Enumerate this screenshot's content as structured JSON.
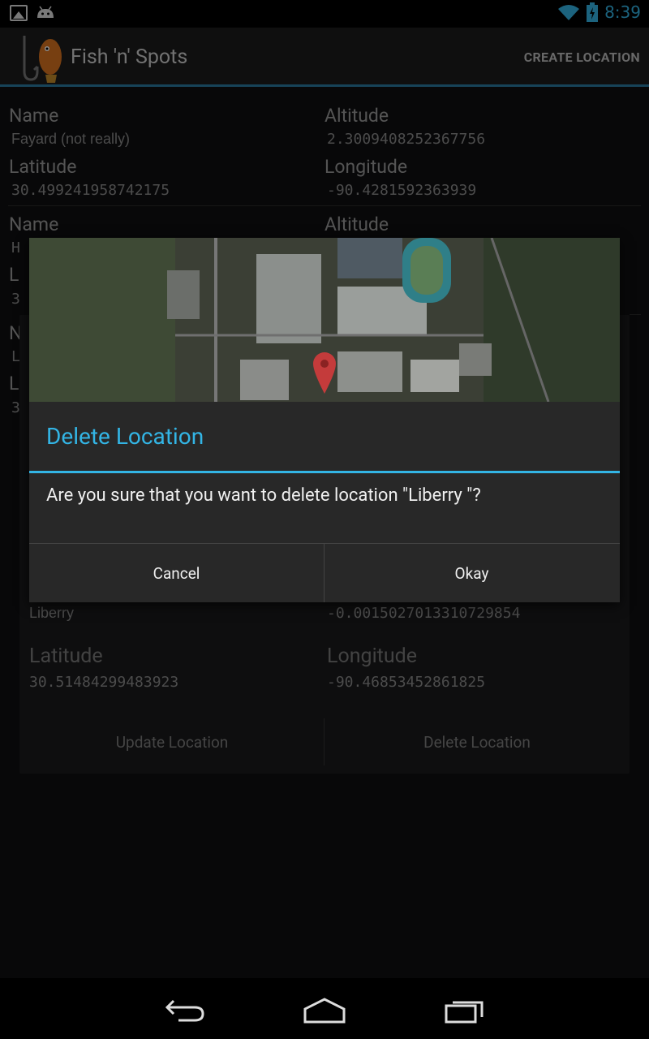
{
  "status_bar": {
    "time": "8:39",
    "left_icons": [
      "image-notification-icon",
      "android-notification-icon"
    ],
    "right_icons": [
      "wifi-icon",
      "battery-charging-icon"
    ],
    "accent_color": "#33b5e5"
  },
  "action_bar": {
    "app_title": "Fish 'n' Spots",
    "create_location_label": "CREATE LOCATION"
  },
  "locations": [
    {
      "name_label": "Name",
      "name": "Fayard (not really)",
      "altitude_label": "Altitude",
      "altitude": "2.3009408252367756",
      "latitude_label": "Latitude",
      "latitude": "30.499241958742175",
      "longitude_label": "Longitude",
      "longitude": "-90.4281592363939"
    }
  ],
  "partial_labels": {
    "name": "Name",
    "altitude": "Altitude",
    "row2_name_initial": "H",
    "row2_lat_initial": "L",
    "row2_lat_value_initial": "3",
    "row3_name_initial": "N",
    "row3_name_value_initial": "L",
    "row3_lat_initial": "L",
    "row3_lat_value_initial": "3"
  },
  "edit_card": {
    "name": "Liberry",
    "altitude": "-0.0015027013310729854",
    "latitude_label": "Latitude",
    "latitude": "30.51484299483923",
    "longitude_label": "Longitude",
    "longitude": "-90.46853452861825",
    "update_button": "Update Location",
    "delete_button": "Delete Location"
  },
  "dialog": {
    "title": "Delete Location",
    "message": "Are you sure that you want to delete location \"Liberry \"?",
    "cancel_label": "Cancel",
    "okay_label": "Okay",
    "map_marker_icon": "map-pin-icon"
  },
  "nav_bar": {
    "icons": [
      "back-icon",
      "home-icon",
      "recent-apps-icon"
    ]
  }
}
